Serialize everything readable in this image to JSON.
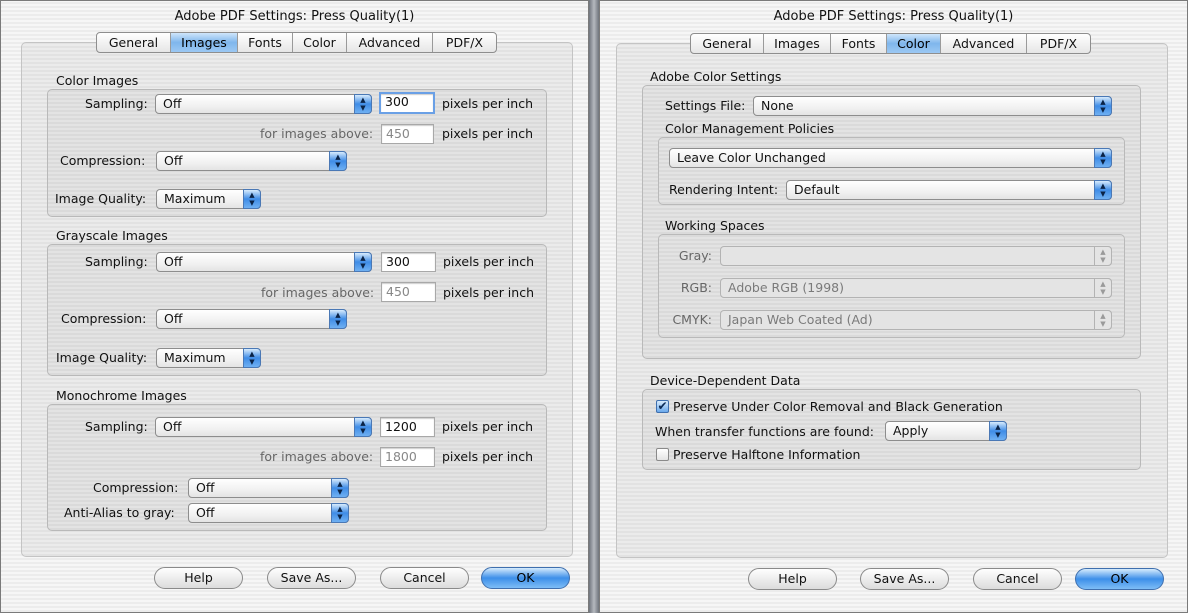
{
  "left": {
    "title": "Adobe PDF Settings: Press Quality(1)",
    "tabs": [
      "General",
      "Images",
      "Fonts",
      "Color",
      "Advanced",
      "PDF/X"
    ],
    "active_tab": "Images",
    "color_images": {
      "heading": "Color Images",
      "sampling_label": "Sampling:",
      "sampling_value": "Off",
      "resolution": "300",
      "unit": "pixels per inch",
      "above_label": "for images above:",
      "above_value": "450",
      "above_unit": "pixels per inch",
      "compression_label": "Compression:",
      "compression_value": "Off",
      "quality_label": "Image Quality:",
      "quality_value": "Maximum"
    },
    "grayscale_images": {
      "heading": "Grayscale Images",
      "sampling_label": "Sampling:",
      "sampling_value": "Off",
      "resolution": "300",
      "unit": "pixels per inch",
      "above_label": "for images above:",
      "above_value": "450",
      "above_unit": "pixels per inch",
      "compression_label": "Compression:",
      "compression_value": "Off",
      "quality_label": "Image Quality:",
      "quality_value": "Maximum"
    },
    "monochrome_images": {
      "heading": "Monochrome Images",
      "sampling_label": "Sampling:",
      "sampling_value": "Off",
      "resolution": "1200",
      "unit": "pixels per inch",
      "above_label": "for images above:",
      "above_value": "1800",
      "above_unit": "pixels per inch",
      "compression_label": "Compression:",
      "compression_value": "Off",
      "antialias_label": "Anti-Alias to gray:",
      "antialias_value": "Off"
    },
    "buttons": {
      "help": "Help",
      "save_as": "Save As...",
      "cancel": "Cancel",
      "ok": "OK"
    }
  },
  "right": {
    "title": "Adobe PDF Settings: Press Quality(1)",
    "tabs": [
      "General",
      "Images",
      "Fonts",
      "Color",
      "Advanced",
      "PDF/X"
    ],
    "active_tab": "Color",
    "adobe_color_settings": {
      "heading": "Adobe Color Settings",
      "settings_file_label": "Settings File:",
      "settings_file_value": "None",
      "policies_heading": "Color Management Policies",
      "policy_value": "Leave Color Unchanged",
      "rendering_label": "Rendering Intent:",
      "rendering_value": "Default",
      "working_spaces_heading": "Working Spaces",
      "gray_label": "Gray:",
      "gray_value": "",
      "rgb_label": "RGB:",
      "rgb_value": "Adobe RGB (1998)",
      "cmyk_label": "CMYK:",
      "cmyk_value": "Japan Web Coated (Ad)"
    },
    "device_dependent": {
      "heading": "Device-Dependent Data",
      "preserve_ucr_label": "Preserve Under Color Removal and Black Generation",
      "preserve_ucr_checked": true,
      "transfer_label": "When transfer functions are found:",
      "transfer_value": "Apply",
      "halftone_label": "Preserve Halftone Information",
      "halftone_checked": false
    },
    "buttons": {
      "help": "Help",
      "save_as": "Save As...",
      "cancel": "Cancel",
      "ok": "OK"
    }
  }
}
